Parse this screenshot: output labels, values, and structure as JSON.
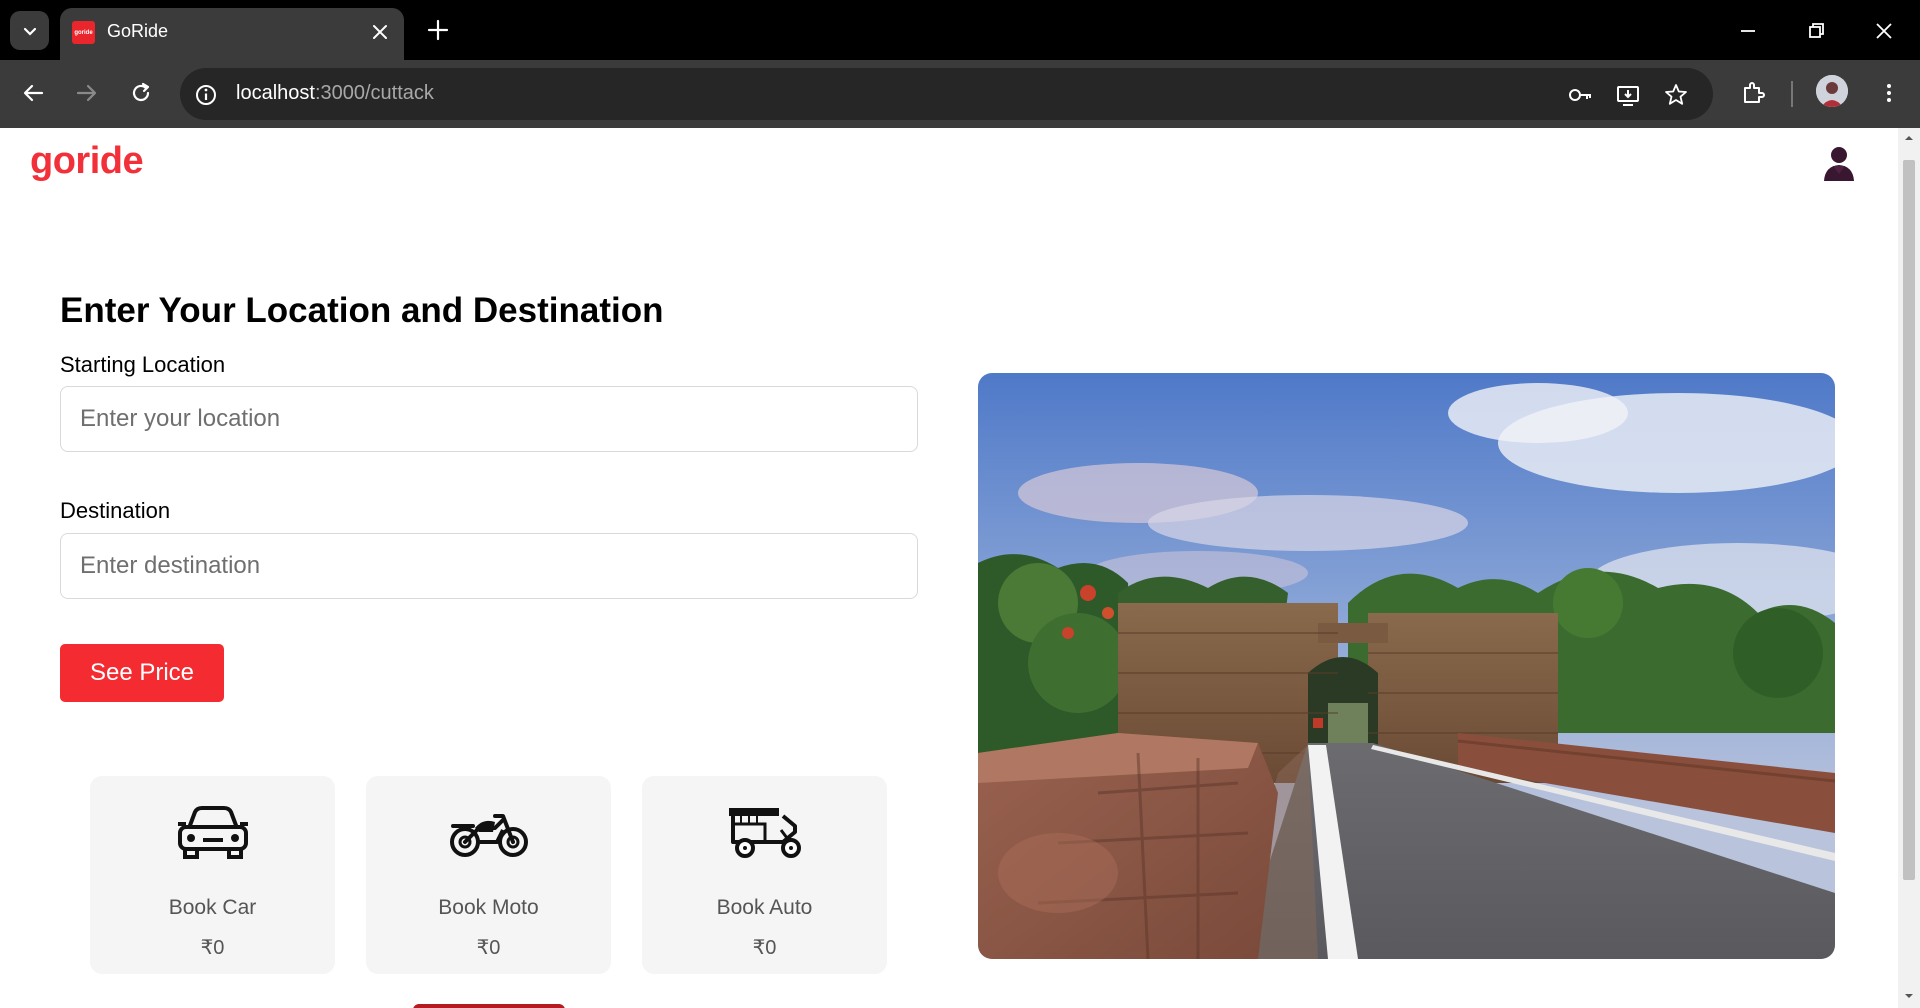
{
  "browser": {
    "tab_title": "GoRide",
    "favicon_text": "goride",
    "url_host": "localhost",
    "url_rest": ":3000/cuttack"
  },
  "header": {
    "logo": "goride",
    "user_icon": "user-icon"
  },
  "form": {
    "heading": "Enter Your Location and Destination",
    "start_label": "Starting Location",
    "start_placeholder": "Enter your location",
    "start_value": "",
    "dest_label": "Destination",
    "dest_placeholder": "Enter destination",
    "dest_value": "",
    "submit_label": "See Price"
  },
  "options": [
    {
      "label": "Book Car",
      "price": "₹0",
      "icon": "car-icon"
    },
    {
      "label": "Book Moto",
      "price": "₹0",
      "icon": "motorcycle-icon"
    },
    {
      "label": "Book Auto",
      "price": "₹0",
      "icon": "auto-rickshaw-icon"
    }
  ],
  "hero": {
    "subject": "stone-gate-road-photo"
  },
  "colors": {
    "brand": "#f2303a",
    "button": "#f42c32",
    "chrome_dark": "#3b3b3b"
  }
}
